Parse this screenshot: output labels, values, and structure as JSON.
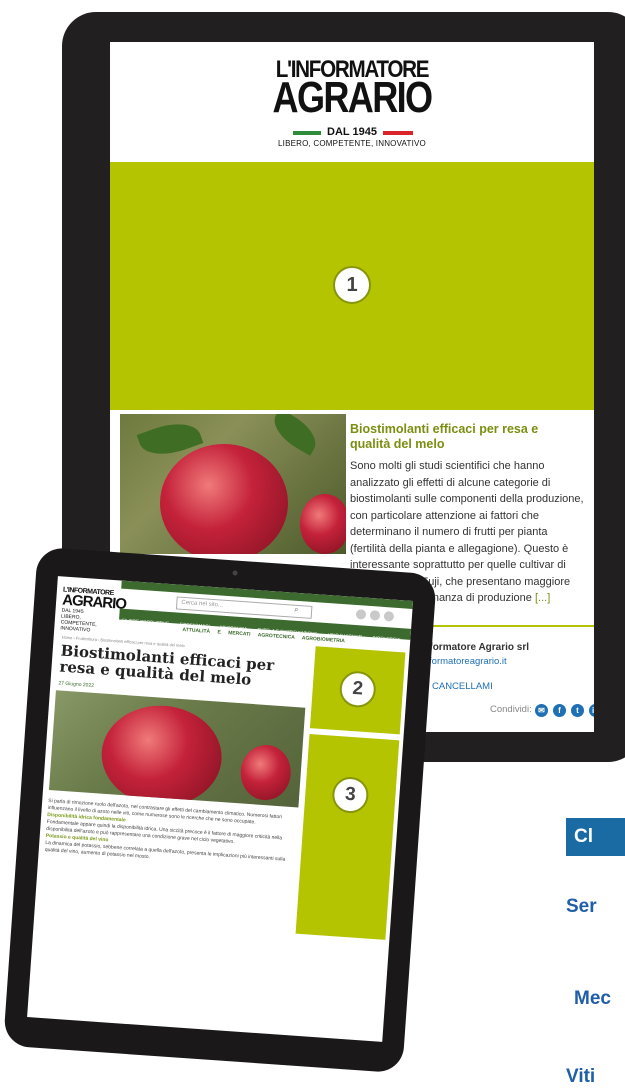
{
  "newsletter": {
    "logo": {
      "line1": "L'INFORMATORE",
      "line2": "AGRARIO",
      "since": "DAL 1945",
      "tagline": "LIBERO, COMPETENTE, INNOVATIVO"
    },
    "slot_numbers": [
      "1",
      "2",
      "3"
    ],
    "article": {
      "title": "Biostimolanti efficaci per resa e qualità del melo",
      "body": "Sono molti gli studi scientifici che hanno analizzato gli effetti di alcune categorie di biostimolanti sulle componenti della produzione, con particolare attenzione ai fattori che determinano il numero di frutti per pianta (fertilità della pianta e allegagione). Questo è interessante soprattutto per quelle cultivar di melo, come la Fuji, che presentano maggiore tendenza all'alternanza di produzione",
      "more": "[...]"
    },
    "footer": {
      "company": "L'Informatore Agrario srl",
      "email": "@informatoreagrario.it",
      "unsubscribe_prefix": "su",
      "unsubscribe": "CANCELLAMI",
      "share_label": "Condividi:",
      "share_icons": [
        "mail-icon",
        "facebook-icon",
        "twitter-icon",
        "linkedin-icon"
      ]
    }
  },
  "website": {
    "logo": {
      "line1": "L'INFORMATORE",
      "line2": "AGRARIO",
      "since": "DAL 1945",
      "tagline": "LIBERO, COMPETENTE, INNOVATIVO"
    },
    "top_links": [
      "ABBONAMENTI",
      "L'INFORMATORE AGRARIO",
      "PUBBLICITÀ",
      "CONTATTI",
      "BANCHE DATI",
      "NEWSLETTER",
      "PRIVACY"
    ],
    "search_placeholder": "Cerca nel sito...",
    "nav": [
      "FILIERE PRODUTTIVE",
      "FITOFARMACI",
      "MECCANICA",
      "TUTELA E CERTIFICAZIONE",
      "VINO E VIGNETI",
      "BIOENERGIE",
      "PRODOTTI E SOLUZIONI"
    ],
    "subnav": [
      "ATTUALITÀ E MERCATI",
      "AGROTECNICA",
      "AGROBIOMETRIA"
    ],
    "breadcrumb": "Home › Frutticoltura › Biostimolanti efficaci per resa e qualità del melo",
    "title": "Biostimolanti efficaci per resa e qualità del melo",
    "date": "27 Giugno 2022",
    "intro": "Si parla di rimozione ruolo dell'azoto, nel contrastare gli effetti del cambiamento climatico. Numerosi fattori influenzano il livello di azoto nelle viti, come numerose sono le ricerche che ne sono occupate.",
    "section1": "Disponibilità idrica fondamentale",
    "section1_text": "Fondamentale appare quindi la disponibilità idrica. Una siccità precoce è il fattore di maggiore criticità nella disponibilità dell'azoto e può rappresentare una condizione grave nel ciclo vegetativo.",
    "section2": "Potassio e qualità del vino",
    "section2_text": "La dinamica del potassio, sebbene correlata a quella dell'azoto, presenta le implicazioni più interessanti sulla qualità del vino, aumento di potassio nel mosto."
  },
  "side_panel": {
    "badge": "Cl",
    "links": [
      "Ser",
      "Mec",
      "Viti"
    ]
  }
}
